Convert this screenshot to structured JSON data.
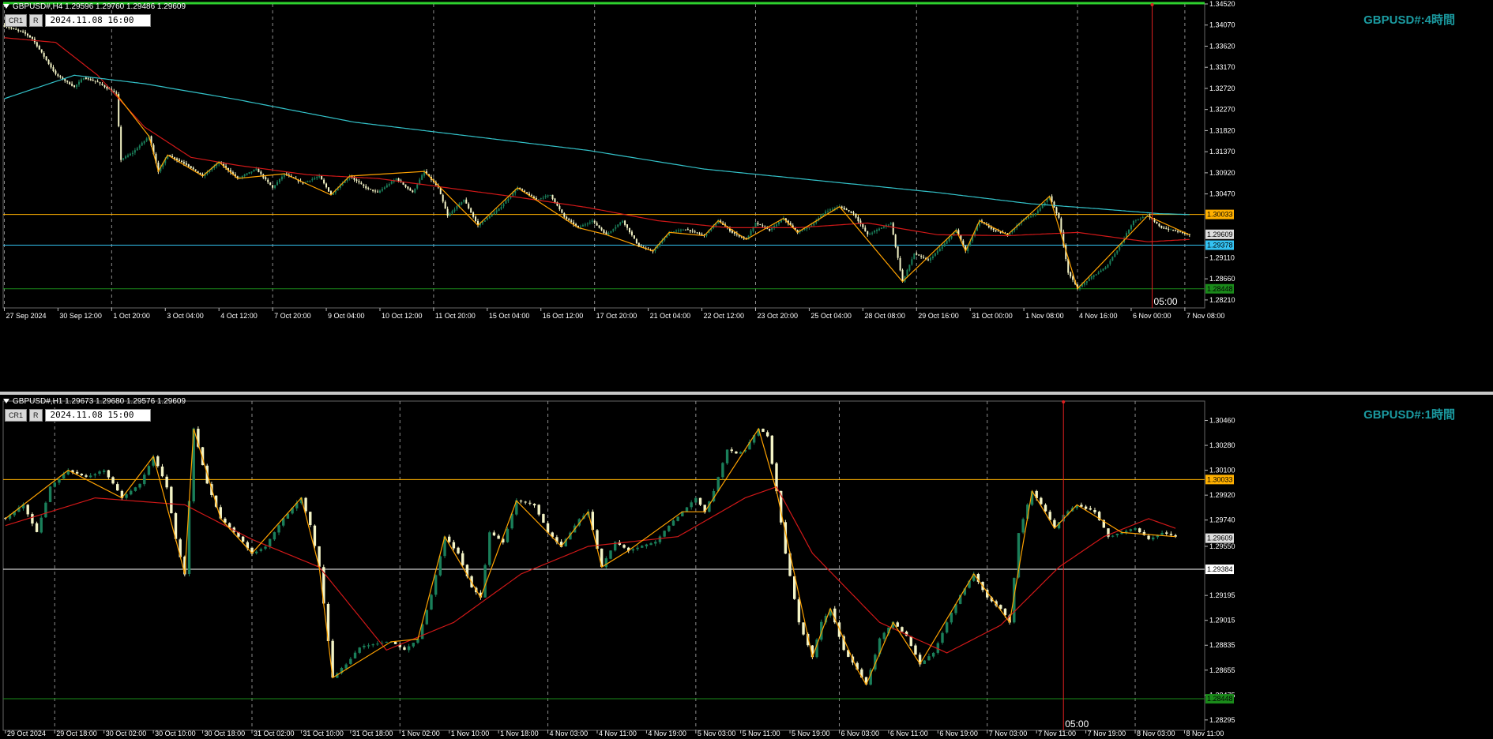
{
  "colors": {
    "background": "#000000",
    "grid": "#8c8c8c",
    "bull": "#1a7f5a",
    "bear": "#f4f4c6",
    "ma_red": "#d01818",
    "ma_cyan": "#33c2c9",
    "zigzag": "#ffa200",
    "line_orange": "#ffb000",
    "line_blue": "#33c2f2",
    "line_green": "#1a8a1a",
    "cursor": "#e02020",
    "title": "#1b9aa0",
    "axis_text": "#ffffff"
  },
  "panels": [
    {
      "header": "GBPUSD#,H4  1.29596 1.29760 1.29486 1.29609",
      "buttons": [
        "CR1",
        "R"
      ],
      "date_box": "2024.11.08 16:00",
      "title": "GBPUSD#:4時間",
      "cursor_label": "05:00"
    },
    {
      "header": "GBPUSD#,H1  1.29673 1.29680 1.29576 1.29609",
      "buttons": [
        "CR1",
        "R"
      ],
      "date_box": "2024.11.08 15:00",
      "title": "GBPUSD#:1時間",
      "cursor_label": "05:00"
    }
  ],
  "chart_data": [
    {
      "type": "candlestick",
      "symbol": "GBPUSD#",
      "timeframe": "H4",
      "ylim": [
        1.2804,
        1.3452
      ],
      "y_ticks": [
        1.3452,
        1.3407,
        1.3362,
        1.3317,
        1.3272,
        1.3227,
        1.3182,
        1.3137,
        1.3092,
        1.3047,
        1.30033,
        1.29609,
        1.29378,
        1.2911,
        1.2866,
        1.28448,
        1.2821
      ],
      "x_labels": [
        "27 Sep 2024",
        "30 Sep 12:00",
        "1 Oct 20:00",
        "3 Oct 04:00",
        "4 Oct 12:00",
        "7 Oct 20:00",
        "9 Oct 04:00",
        "10 Oct 12:00",
        "11 Oct 20:00",
        "15 Oct 04:00",
        "16 Oct 12:00",
        "17 Oct 20:00",
        "21 Oct 04:00",
        "22 Oct 12:00",
        "23 Oct 20:00",
        "25 Oct 04:00",
        "28 Oct 08:00",
        "29 Oct 16:00",
        "31 Oct 00:00",
        "1 Nov 08:00",
        "4 Nov 16:00",
        "6 Nov 00:00",
        "7 Nov 08:00"
      ],
      "grid_labels": [
        "27 Sep 2024",
        "1 Oct 20:00",
        "7 Oct 20:00",
        "11 Oct 20:00",
        "17 Oct 20:00",
        "23 Oct 20:00",
        "29 Oct 16:00",
        "4 Nov 16:00",
        "7 Nov 08:00"
      ],
      "anchors": [
        [
          0,
          1.3405
        ],
        [
          8,
          1.3392
        ],
        [
          12,
          1.3378
        ],
        [
          22,
          1.3302
        ],
        [
          30,
          1.3275
        ],
        [
          34,
          1.3295
        ],
        [
          40,
          1.3285
        ],
        [
          48,
          1.326
        ],
        [
          50,
          1.312
        ],
        [
          55,
          1.3135
        ],
        [
          62,
          1.317
        ],
        [
          66,
          1.3095
        ],
        [
          70,
          1.313
        ],
        [
          78,
          1.311
        ],
        [
          85,
          1.3085
        ],
        [
          92,
          1.3115
        ],
        [
          100,
          1.308
        ],
        [
          108,
          1.31
        ],
        [
          115,
          1.306
        ],
        [
          120,
          1.309
        ],
        [
          128,
          1.307
        ],
        [
          135,
          1.3085
        ],
        [
          140,
          1.3045
        ],
        [
          148,
          1.3085
        ],
        [
          155,
          1.306
        ],
        [
          160,
          1.305
        ],
        [
          168,
          1.308
        ],
        [
          175,
          1.305
        ],
        [
          180,
          1.3095
        ],
        [
          186,
          1.306
        ],
        [
          190,
          1.3
        ],
        [
          197,
          1.3035
        ],
        [
          203,
          1.298
        ],
        [
          212,
          1.3015
        ],
        [
          220,
          1.306
        ],
        [
          228,
          1.3035
        ],
        [
          234,
          1.3045
        ],
        [
          240,
          1.2998
        ],
        [
          246,
          1.2975
        ],
        [
          252,
          1.299
        ],
        [
          258,
          1.296
        ],
        [
          265,
          1.299
        ],
        [
          272,
          1.2935
        ],
        [
          278,
          1.2925
        ],
        [
          285,
          1.2965
        ],
        [
          292,
          1.2972
        ],
        [
          300,
          1.2958
        ],
        [
          306,
          1.299
        ],
        [
          312,
          1.2965
        ],
        [
          318,
          1.295
        ],
        [
          322,
          1.2985
        ],
        [
          328,
          1.297
        ],
        [
          334,
          1.2995
        ],
        [
          340,
          1.2965
        ],
        [
          346,
          1.298
        ],
        [
          352,
          1.301
        ],
        [
          358,
          1.302
        ],
        [
          364,
          1.3005
        ],
        [
          370,
          1.296
        ],
        [
          376,
          1.2975
        ],
        [
          380,
          1.2985
        ],
        [
          385,
          1.286
        ],
        [
          390,
          1.292
        ],
        [
          396,
          1.2905
        ],
        [
          402,
          1.2935
        ],
        [
          408,
          1.297
        ],
        [
          412,
          1.2925
        ],
        [
          418,
          1.299
        ],
        [
          424,
          1.297
        ],
        [
          430,
          1.296
        ],
        [
          436,
          1.299
        ],
        [
          442,
          1.3005
        ],
        [
          448,
          1.3042
        ],
        [
          452,
          1.2995
        ],
        [
          456,
          1.288
        ],
        [
          460,
          1.2845
        ],
        [
          466,
          1.287
        ],
        [
          472,
          1.289
        ],
        [
          478,
          1.2935
        ],
        [
          484,
          1.299
        ],
        [
          490,
          1.3
        ],
        [
          496,
          1.2975
        ],
        [
          502,
          1.2968
        ],
        [
          508,
          1.296
        ]
      ],
      "count": 509,
      "ma_red_anchors": [
        [
          0,
          1.338
        ],
        [
          22,
          1.337
        ],
        [
          40,
          1.33
        ],
        [
          60,
          1.319
        ],
        [
          80,
          1.3125
        ],
        [
          100,
          1.3108
        ],
        [
          130,
          1.3088
        ],
        [
          160,
          1.308
        ],
        [
          190,
          1.306
        ],
        [
          220,
          1.304
        ],
        [
          250,
          1.3018
        ],
        [
          280,
          1.299
        ],
        [
          310,
          1.2975
        ],
        [
          340,
          1.2975
        ],
        [
          370,
          1.2985
        ],
        [
          400,
          1.296
        ],
        [
          430,
          1.2958
        ],
        [
          460,
          1.2965
        ],
        [
          490,
          1.2945
        ],
        [
          508,
          1.295
        ]
      ],
      "ma_cyan_anchors": [
        [
          0,
          1.325
        ],
        [
          30,
          1.33
        ],
        [
          60,
          1.3282
        ],
        [
          100,
          1.3248
        ],
        [
          150,
          1.32
        ],
        [
          200,
          1.317
        ],
        [
          250,
          1.314
        ],
        [
          300,
          1.31
        ],
        [
          350,
          1.3075
        ],
        [
          400,
          1.305
        ],
        [
          440,
          1.3026
        ],
        [
          470,
          1.3015
        ],
        [
          495,
          1.3005
        ],
        [
          508,
          1.3003
        ]
      ],
      "zigzag_indices": [
        48,
        62,
        66,
        70,
        85,
        92,
        100,
        120,
        140,
        148,
        180,
        203,
        220,
        246,
        258,
        278,
        285,
        300,
        306,
        318,
        334,
        340,
        358,
        385,
        408,
        412,
        418,
        430,
        448,
        460,
        490,
        508
      ],
      "hlines": [
        {
          "price": 1.30033,
          "label": "1.30033",
          "color": "#ffb000"
        },
        {
          "price": 1.29378,
          "label": "1.29378",
          "color": "#33c2f2"
        },
        {
          "price": 1.28448,
          "label": "1.28448",
          "color": "#1a8a1a"
        }
      ],
      "current_price": "1.29609",
      "cursor_index": 492
    },
    {
      "type": "candlestick",
      "symbol": "GBPUSD#",
      "timeframe": "H1",
      "ylim": [
        1.2822,
        1.306
      ],
      "y_ticks": [
        1.3046,
        1.3028,
        1.301,
        1.30033,
        1.2992,
        1.2974,
        1.29609,
        1.2955,
        1.29384,
        1.29195,
        1.29015,
        1.28835,
        1.28655,
        1.28475,
        1.28295
      ],
      "x_labels": [
        "29 Oct 2024",
        "29 Oct 18:00",
        "30 Oct 02:00",
        "30 Oct 10:00",
        "30 Oct 18:00",
        "31 Oct 02:00",
        "31 Oct 10:00",
        "31 Oct 18:00",
        "1 Nov 02:00",
        "1 Nov 10:00",
        "1 Nov 18:00",
        "4 Nov 03:00",
        "4 Nov 11:00",
        "4 Nov 19:00",
        "5 Nov 03:00",
        "5 Nov 11:00",
        "5 Nov 19:00",
        "6 Nov 03:00",
        "6 Nov 11:00",
        "6 Nov 19:00",
        "7 Nov 03:00",
        "7 Nov 11:00",
        "7 Nov 19:00",
        "8 Nov 03:00",
        "8 Nov 11:00"
      ],
      "grid_labels": [
        "29 Oct 18:00",
        "31 Oct 02:00",
        "1 Nov 02:00",
        "4 Nov 03:00",
        "5 Nov 03:00",
        "6 Nov 03:00",
        "7 Nov 03:00",
        "8 Nov 03:00"
      ],
      "anchors": [
        [
          0,
          1.2975
        ],
        [
          4,
          1.2985
        ],
        [
          7,
          1.2965
        ],
        [
          10,
          1.2998
        ],
        [
          14,
          1.301
        ],
        [
          18,
          1.3005
        ],
        [
          22,
          1.301
        ],
        [
          26,
          1.299
        ],
        [
          30,
          1.3
        ],
        [
          33,
          1.302
        ],
        [
          36,
          1.2998
        ],
        [
          38,
          1.296
        ],
        [
          40,
          1.2935
        ],
        [
          42,
          1.304
        ],
        [
          45,
          1.3
        ],
        [
          48,
          1.2975
        ],
        [
          52,
          1.2962
        ],
        [
          55,
          1.295
        ],
        [
          58,
          1.2955
        ],
        [
          62,
          1.2975
        ],
        [
          66,
          1.299
        ],
        [
          68,
          1.297
        ],
        [
          70,
          1.294
        ],
        [
          73,
          1.286
        ],
        [
          76,
          1.287
        ],
        [
          79,
          1.2882
        ],
        [
          83,
          1.2885
        ],
        [
          86,
          1.2886
        ],
        [
          89,
          1.288
        ],
        [
          92,
          1.2888
        ],
        [
          95,
          1.292
        ],
        [
          98,
          1.2962
        ],
        [
          101,
          1.295
        ],
        [
          104,
          1.2925
        ],
        [
          106,
          1.2918
        ],
        [
          108,
          1.2965
        ],
        [
          111,
          1.2958
        ],
        [
          114,
          1.2988
        ],
        [
          118,
          1.2985
        ],
        [
          121,
          1.2965
        ],
        [
          124,
          1.2955
        ],
        [
          128,
          1.2975
        ],
        [
          130,
          1.298
        ],
        [
          133,
          1.294
        ],
        [
          136,
          1.2958
        ],
        [
          139,
          1.2952
        ],
        [
          142,
          1.2955
        ],
        [
          145,
          1.2958
        ],
        [
          148,
          1.297
        ],
        [
          151,
          1.298
        ],
        [
          154,
          1.299
        ],
        [
          156,
          1.298
        ],
        [
          158,
          1.2995
        ],
        [
          161,
          1.3025
        ],
        [
          163,
          1.3022
        ],
        [
          165,
          1.3025
        ],
        [
          168,
          1.304
        ],
        [
          170,
          1.3035
        ],
        [
          172,
          1.2995
        ],
        [
          174,
          1.295
        ],
        [
          177,
          1.29
        ],
        [
          180,
          1.2875
        ],
        [
          182,
          1.29
        ],
        [
          184,
          1.291
        ],
        [
          187,
          1.288
        ],
        [
          190,
          1.2866
        ],
        [
          192,
          1.2855
        ],
        [
          195,
          1.2888
        ],
        [
          198,
          1.29
        ],
        [
          201,
          1.289
        ],
        [
          204,
          1.287
        ],
        [
          207,
          1.2878
        ],
        [
          210,
          1.29
        ],
        [
          213,
          1.292
        ],
        [
          216,
          1.2935
        ],
        [
          219,
          1.2918
        ],
        [
          222,
          1.291
        ],
        [
          224,
          1.29
        ],
        [
          226,
          1.2965
        ],
        [
          229,
          1.2995
        ],
        [
          232,
          1.298
        ],
        [
          234,
          1.2968
        ],
        [
          236,
          1.2978
        ],
        [
          239,
          1.2985
        ],
        [
          243,
          1.298
        ],
        [
          246,
          1.2962
        ],
        [
          249,
          1.2965
        ],
        [
          252,
          1.2968
        ],
        [
          255,
          1.296
        ],
        [
          258,
          1.2965
        ],
        [
          261,
          1.2962
        ]
      ],
      "count": 262,
      "ma_red_anchors": [
        [
          0,
          1.297
        ],
        [
          20,
          1.299
        ],
        [
          40,
          1.2985
        ],
        [
          55,
          1.296
        ],
        [
          70,
          1.294
        ],
        [
          85,
          1.288
        ],
        [
          100,
          1.29
        ],
        [
          115,
          1.2935
        ],
        [
          130,
          1.2955
        ],
        [
          150,
          1.2962
        ],
        [
          165,
          1.299
        ],
        [
          172,
          1.2998
        ],
        [
          180,
          1.295
        ],
        [
          195,
          1.29
        ],
        [
          210,
          1.2878
        ],
        [
          222,
          1.2898
        ],
        [
          235,
          1.294
        ],
        [
          245,
          1.2962
        ],
        [
          255,
          1.2975
        ],
        [
          261,
          1.2968
        ]
      ],
      "zigzag_indices": [
        0,
        14,
        26,
        33,
        38,
        40,
        42,
        48,
        55,
        66,
        70,
        73,
        86,
        92,
        98,
        106,
        114,
        124,
        130,
        133,
        139,
        151,
        156,
        168,
        172,
        180,
        184,
        190,
        192,
        198,
        204,
        216,
        224,
        229,
        234,
        239,
        249,
        261
      ],
      "hlines": [
        {
          "price": 1.30033,
          "label": "1.30033",
          "color": "#ffb000"
        },
        {
          "price": 1.29384,
          "label": "1.29384",
          "color": "#ffffff"
        },
        {
          "price": 1.28448,
          "label": "1.28448",
          "color": "#1a8a1a"
        }
      ],
      "current_price": "1.29609",
      "cursor_index": 236
    }
  ]
}
